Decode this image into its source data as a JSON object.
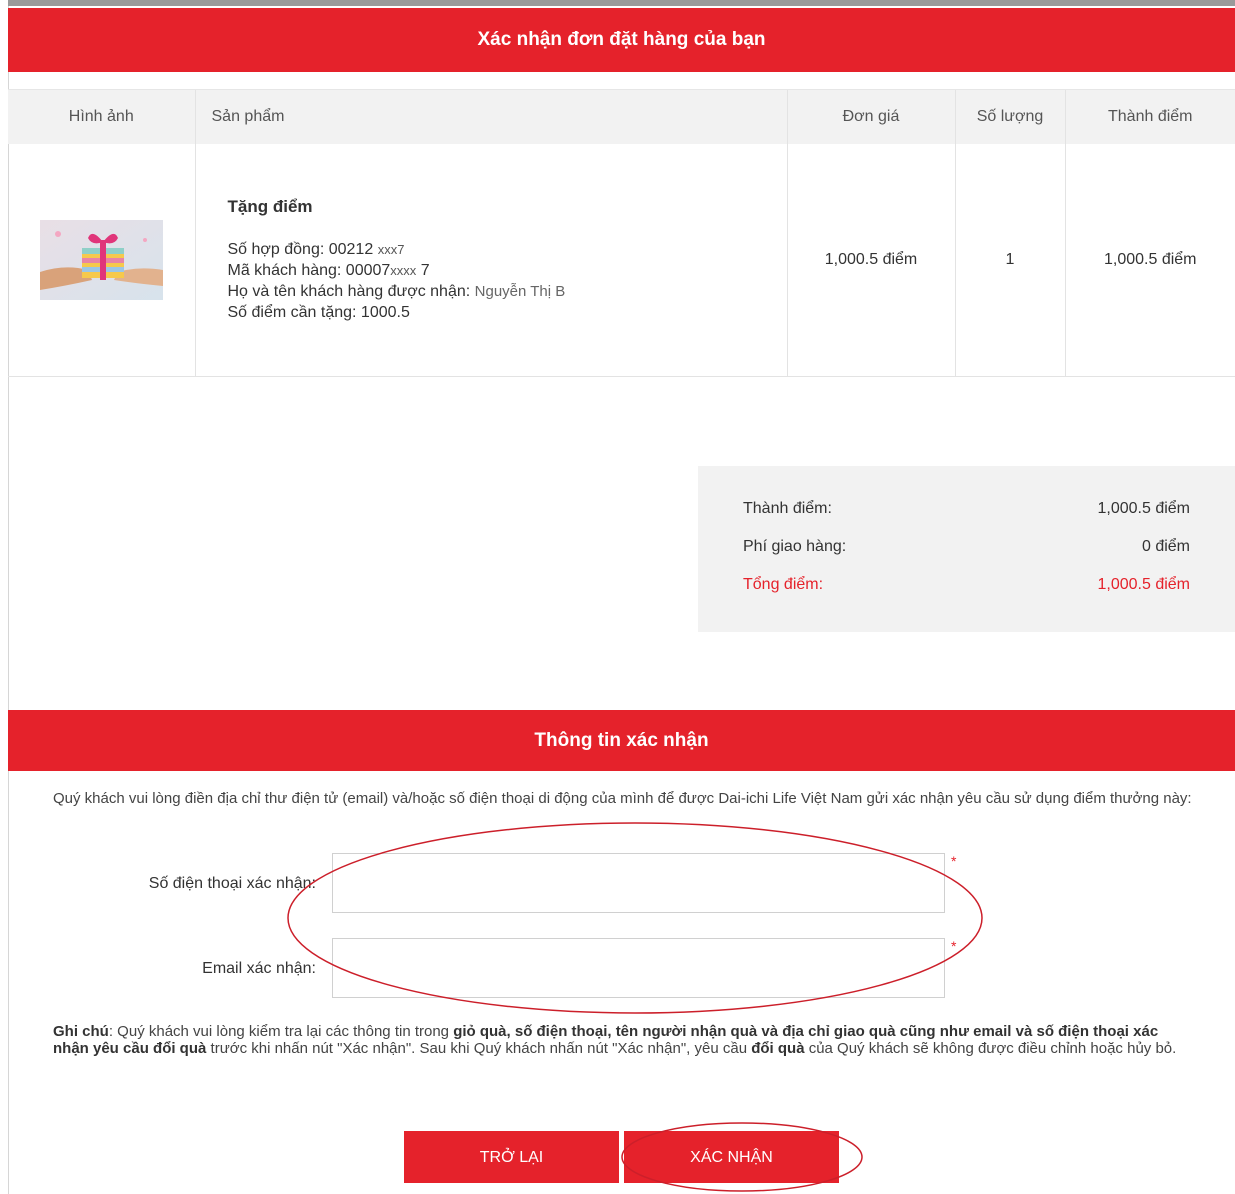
{
  "header": {
    "title": "Xác nhận đơn đặt hàng của bạn"
  },
  "cart": {
    "columns": [
      "Hình ảnh",
      "Sản phẩm",
      "Đơn giá",
      "Số lượng",
      "Thành điểm"
    ],
    "item": {
      "name": "Tặng điểm",
      "contract_label": "Số hợp đồng: 00212",
      "contract_masked": "xxx7",
      "customer_label": "Mã khách hàng: 00007",
      "customer_masked": "xxxx",
      "customer_tail": "7",
      "recipient_label": "Họ và tên khách hàng được nhận:",
      "recipient_value": "Nguyễn Thị B",
      "points_label": "Số điểm cần tặng: 1000.5",
      "unit_price": "1,000.5 điểm",
      "quantity": "1",
      "total": "1,000.5 điểm"
    }
  },
  "summary": {
    "subtotal_label": "Thành điểm:",
    "subtotal_value": "1,000.5 điểm",
    "shipping_label": "Phí giao hàng:",
    "shipping_value": "0 điểm",
    "total_label": "Tổng điểm:",
    "total_value": "1,000.5 điểm",
    "total_color": "#e5222b"
  },
  "confirm": {
    "title": "Thông tin xác nhận",
    "intro": "Quý khách vui lòng điền địa chỉ thư điện tử (email) và/hoặc số điện thoại di động của mình để được Dai-ichi Life Việt Nam gửi xác nhận yêu cầu sử dụng điểm thưởng này:",
    "phone_label": "Số điện thoại xác nhận:",
    "phone_value": "",
    "email_label": "Email xác nhận:",
    "email_value": "",
    "required_mark": "*",
    "note_label": "Ghi chú",
    "note_part1": ": Quý khách vui lòng kiểm tra lại các thông tin trong ",
    "note_bold": "giỏ quà, số điện thoại, tên người nhận quà và địa chỉ giao quà cũng như email và số điện thoại xác nhận yêu cầu đổi quà",
    "note_part2": " trước khi nhấn nút \"Xác nhận\". Sau khi Quý khách nhấn nút \"Xác nhận\", yêu cầu ",
    "note_bold2": "đổi quà",
    "note_part3": " của Quý khách sẽ không được điều chỉnh hoặc hủy bỏ."
  },
  "buttons": {
    "back": "TRỞ LẠI",
    "confirm": "XÁC NHẬN"
  },
  "colors": {
    "accent": "#e5222b",
    "panel": "#f2f2f2"
  }
}
